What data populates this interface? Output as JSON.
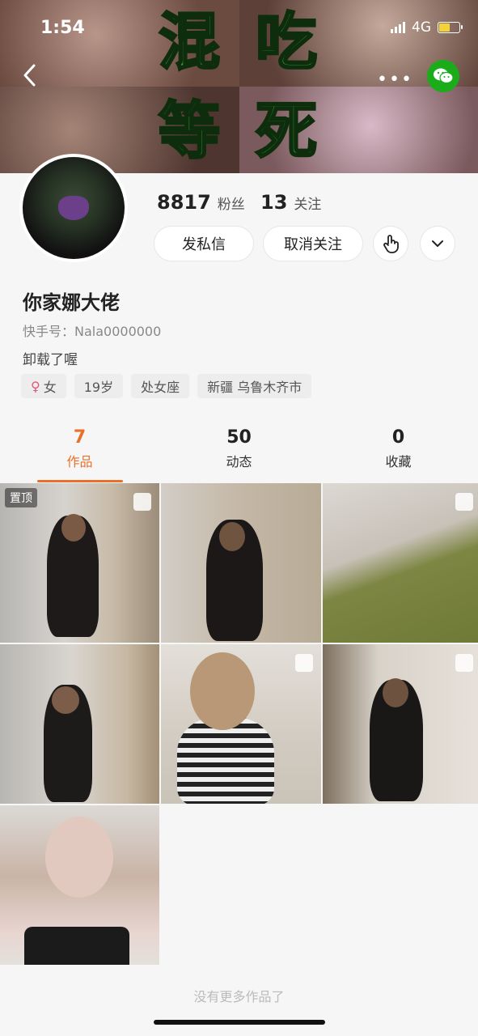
{
  "status_bar": {
    "time": "1:54",
    "network": "4G"
  },
  "banner": {
    "chars": [
      "混",
      "吃",
      "等",
      "死"
    ]
  },
  "profile": {
    "followers_count": "8817",
    "followers_label": "粉丝",
    "following_count": "13",
    "following_label": "关注",
    "message_button": "发私信",
    "unfollow_button": "取消关注",
    "name": "你家娜大佬",
    "kuaishou_id": "快手号：Nala0000000",
    "bio": "卸载了喔",
    "tags": [
      "女",
      "19岁",
      "处女座",
      "新疆 乌鲁木齐市"
    ]
  },
  "tabs": [
    {
      "count": "7",
      "label": "作品"
    },
    {
      "count": "50",
      "label": "动态"
    },
    {
      "count": "0",
      "label": "收藏"
    }
  ],
  "grid": {
    "pinned_label": "置顶"
  },
  "footer": "没有更多作品了",
  "colors": {
    "accent": "#e8702a",
    "wechat": "#1aad19",
    "banner_text": "#3c9a3a"
  }
}
